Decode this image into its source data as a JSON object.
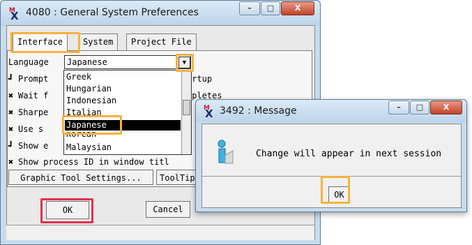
{
  "main_window": {
    "title": "4080 : General System Preferences",
    "tabs": [
      {
        "label": "Interface"
      },
      {
        "label": "System"
      },
      {
        "label": "Project File"
      }
    ],
    "language": {
      "label": "Language",
      "value": "Japanese"
    },
    "options": [
      {
        "checked": false,
        "label": "Prompt",
        "suffix": "artup"
      },
      {
        "checked": true,
        "label": "Wait f",
        "suffix": "npletes"
      },
      {
        "checked": true,
        "label": "Sharpe",
        "suffix": ""
      },
      {
        "checked": true,
        "label": "Use s",
        "suffix": ""
      },
      {
        "checked": false,
        "label": "Show e",
        "suffix": ""
      },
      {
        "checked": true,
        "label": "Show process ID in window titl",
        "suffix": ""
      }
    ],
    "language_options": [
      "Greek",
      "Hungarian",
      "Indonesian",
      "Italian",
      "Japanese",
      "Korean",
      "Malaysian"
    ],
    "selected_language_index": 4,
    "buttons": {
      "graphic_tool_settings": "Graphic Tool Settings...",
      "tooltips": "ToolTip",
      "ok": "OK",
      "cancel": "Cancel"
    },
    "checkbox_glyphs": {
      "checked": "✖",
      "unchecked": "┛"
    }
  },
  "message_window": {
    "title": "3492 : Message",
    "message": "Change will appear in next session",
    "ok": "OK"
  },
  "window_controls": {
    "minimize": "–",
    "maximize": "□",
    "close": "X"
  },
  "colors": {
    "highlight_orange": "#f7b23e",
    "highlight_red": "#e5304d",
    "titlebar": "#c8dced"
  }
}
